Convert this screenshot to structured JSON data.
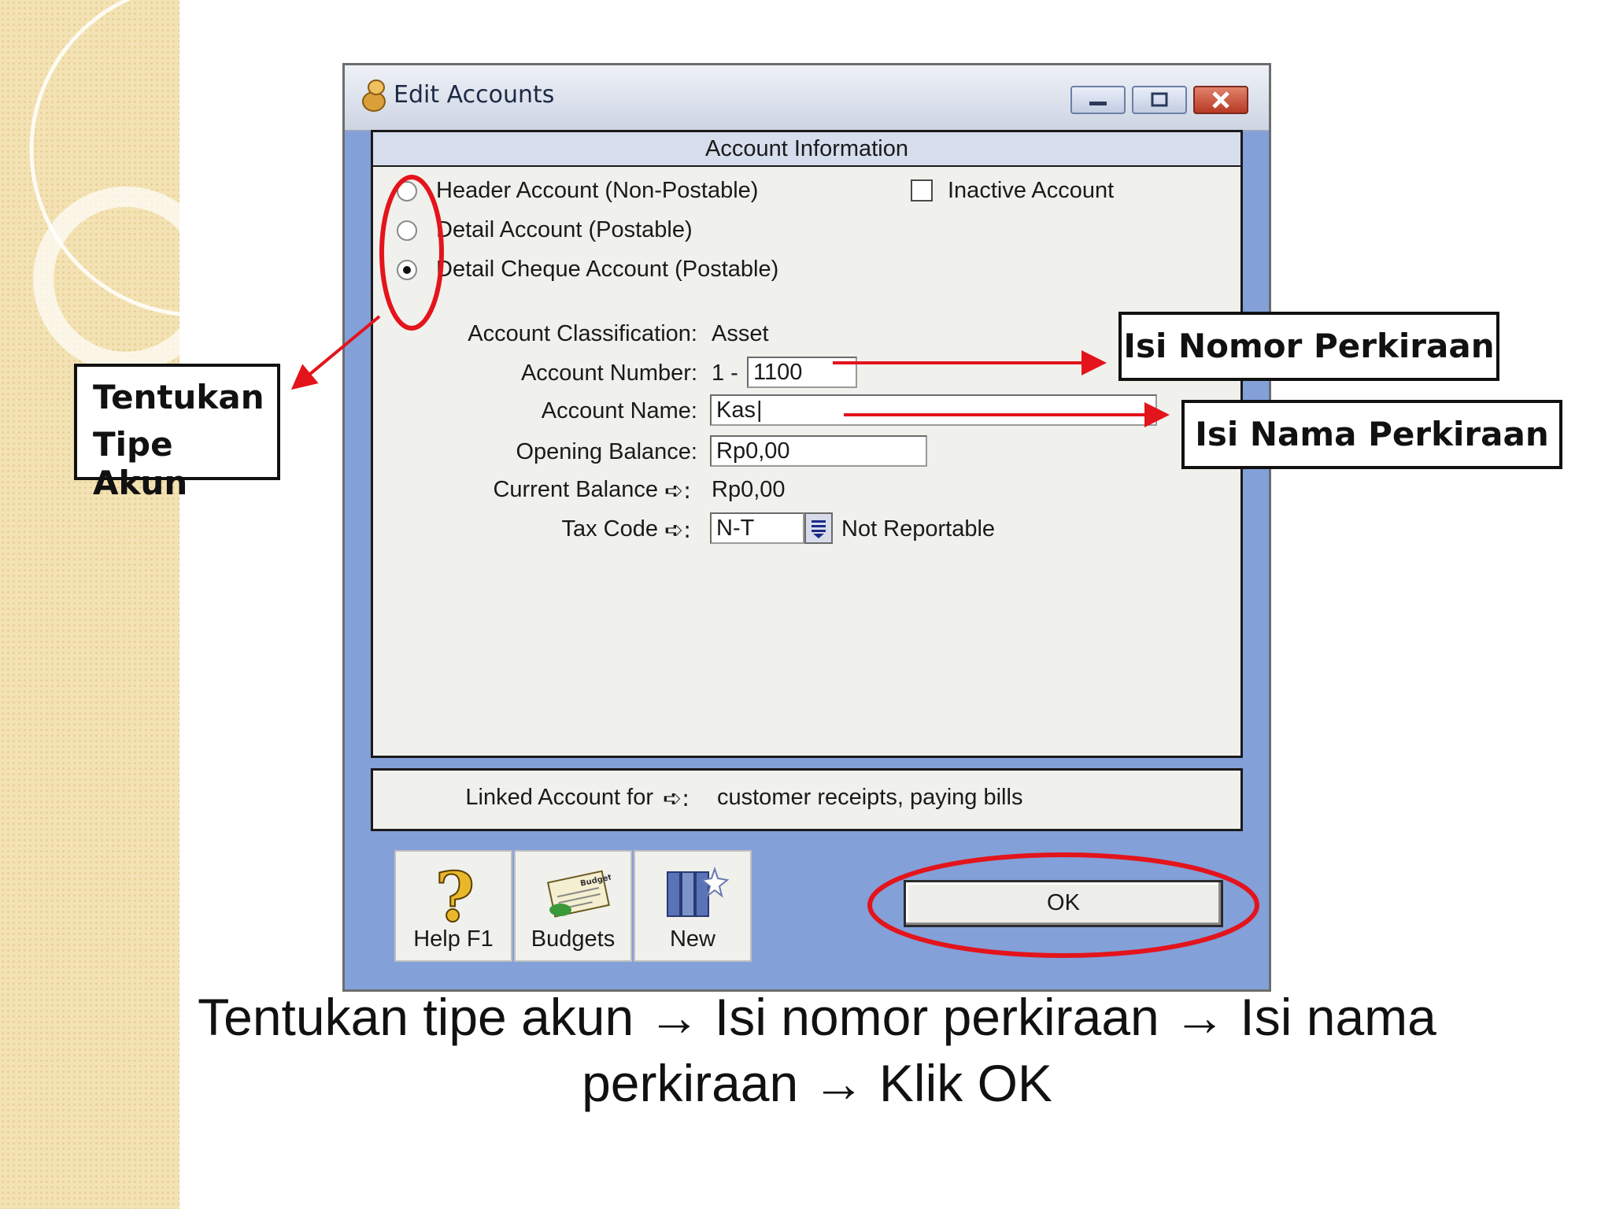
{
  "window": {
    "title": "Edit Accounts",
    "panel_title": "Account Information",
    "account_types": [
      {
        "label": "Header Account (Non-Postable)",
        "checked": false
      },
      {
        "label": "Detail Account (Postable)",
        "checked": false
      },
      {
        "label": "Detail Cheque Account (Postable)",
        "checked": true
      }
    ],
    "inactive": {
      "label": "Inactive Account",
      "checked": false
    },
    "fields": {
      "classification_label": "Account Classification:",
      "classification_value": "Asset",
      "number_label": "Account Number:",
      "number_prefix": "1 -",
      "number_value": "1100",
      "name_label": "Account Name:",
      "name_value": "Kas",
      "opening_label": "Opening Balance:",
      "opening_value": "Rp0,00",
      "current_label": "Current Balance",
      "current_value": "Rp0,00",
      "tax_label": "Tax Code",
      "tax_value": "N-T",
      "tax_desc": "Not Reportable",
      "arrow": "➪:"
    },
    "linked": {
      "label": "Linked Account for",
      "value": "customer receipts, paying bills"
    },
    "toolbar": {
      "help": "Help F1",
      "budgets": "Budgets",
      "budget_icon_text": "Budget",
      "new": "New"
    },
    "ok": "OK"
  },
  "annotations": {
    "tipe_line1": "Tentukan",
    "tipe_line2": "Tipe Akun",
    "nomor": "Isi Nomor Perkiraan",
    "nama": "Isi Nama Perkiraan",
    "caption_line1": "Tentukan tipe akun → Isi nomor perkiraan → Isi nama",
    "caption_line2": "perkiraan →  Klik OK",
    "color": "#e3141c"
  }
}
